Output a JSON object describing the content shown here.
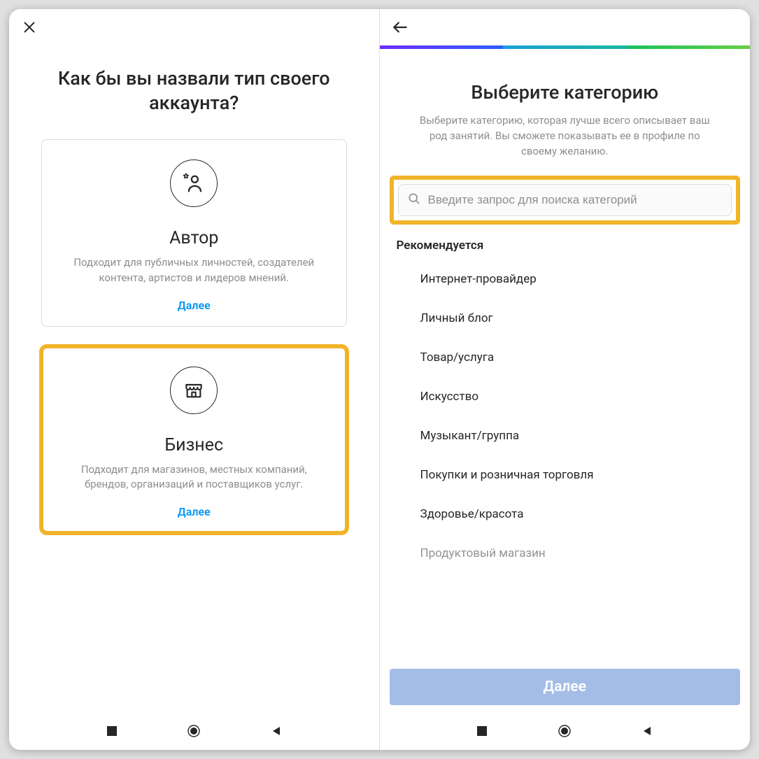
{
  "left": {
    "heading": "Как бы вы назвали тип своего аккаунта?",
    "cards": [
      {
        "title": "Автор",
        "desc": "Подходит для публичных личностей, создателей контента, артистов и лидеров мнений.",
        "next": "Далее"
      },
      {
        "title": "Бизнес",
        "desc": "Подходит для магазинов, местных компаний, брендов, организаций и поставщиков услуг.",
        "next": "Далее"
      }
    ]
  },
  "right": {
    "heading": "Выберите категорию",
    "subtext": "Выберите категорию, которая лучше всего описывает ваш род занятий. Вы сможете показывать ее в профиле по своему желанию.",
    "search_placeholder": "Введите запрос для поиска категорий",
    "section_label": "Рекомендуется",
    "categories": [
      "Интернет-провайдер",
      "Личный блог",
      "Товар/услуга",
      "Искусство",
      "Музыкант/группа",
      "Покупки и розничная торговля",
      "Здоровье/красота",
      "Продуктовый магазин"
    ],
    "next_button": "Далее"
  }
}
